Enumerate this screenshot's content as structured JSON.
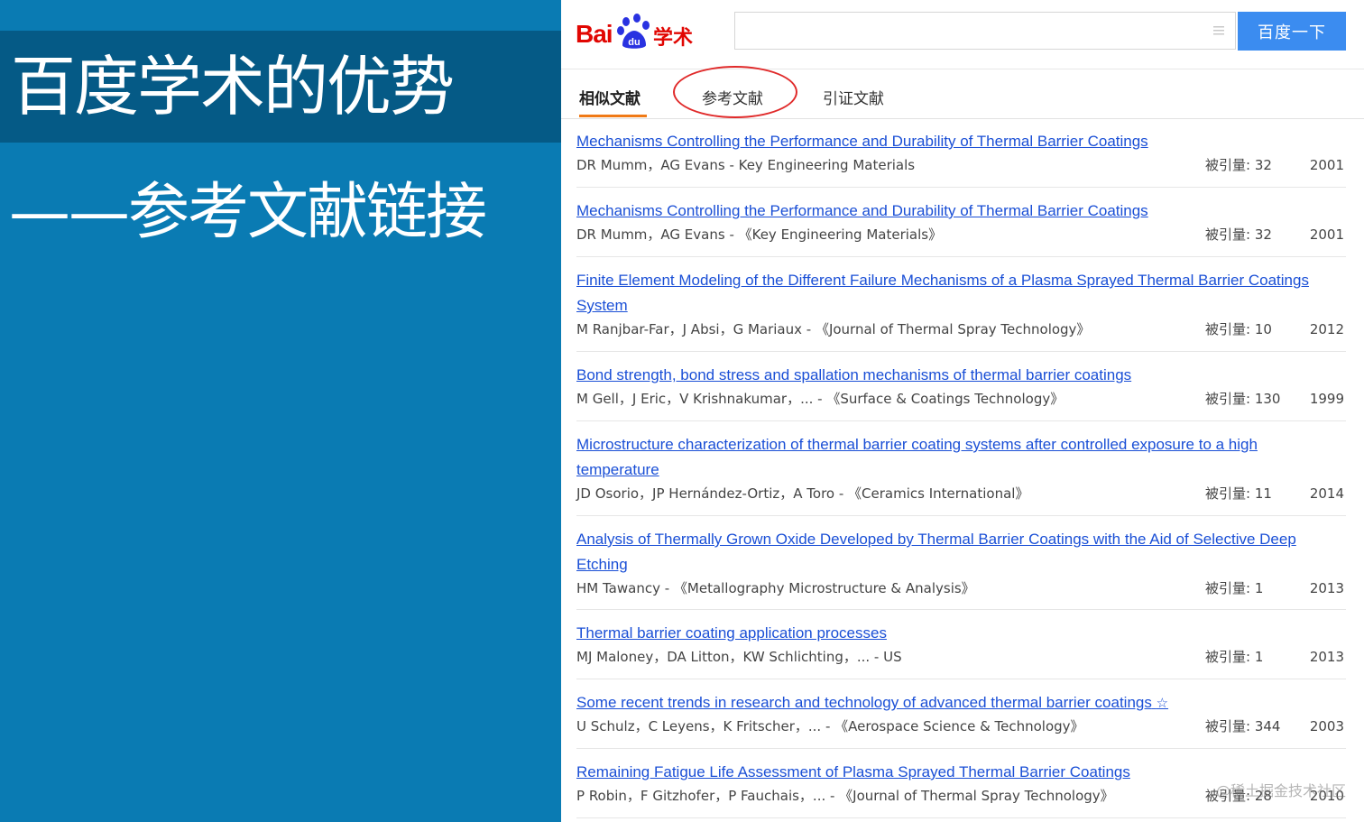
{
  "slide": {
    "title": "百度学术的优势",
    "subtitle": "——参考文献链接"
  },
  "header": {
    "logo_bai": "Bai",
    "logo_du": "du",
    "logo_xueshu": "学术",
    "search_value": "",
    "search_button": "百度一下"
  },
  "tabs": [
    {
      "label": "相似文献",
      "active": true
    },
    {
      "label": "参考文献",
      "active": false
    },
    {
      "label": "引证文献",
      "active": false
    }
  ],
  "results": [
    {
      "title": "Mechanisms Controlling the Performance and Durability of Thermal Barrier Coatings",
      "meta": "DR Mumm，AG Evans - Key Engineering Materials",
      "cite": "被引量: 32",
      "year": "2001"
    },
    {
      "title": "Mechanisms Controlling the Performance and Durability of Thermal Barrier Coatings",
      "meta": "DR Mumm，AG Evans - 《Key Engineering Materials》",
      "cite": "被引量: 32",
      "year": "2001"
    },
    {
      "title": "Finite Element Modeling of the Different Failure Mechanisms of a Plasma Sprayed Thermal Barrier Coatings System",
      "meta": "M Ranjbar-Far，J Absi，G Mariaux - 《Journal of Thermal Spray Technology》",
      "cite": "被引量: 10",
      "year": "2012"
    },
    {
      "title": "Bond strength, bond stress and spallation mechanisms of thermal barrier coatings",
      "meta": "M Gell，J Eric，V Krishnakumar，... - 《Surface & Coatings Technology》",
      "cite": "被引量: 130",
      "year": "1999"
    },
    {
      "title": "Microstructure characterization of thermal barrier coating systems after controlled exposure to a high temperature",
      "meta": "JD Osorio，JP Hernández-Ortiz，A Toro - 《Ceramics International》",
      "cite": "被引量: 11",
      "year": "2014"
    },
    {
      "title": "Analysis of Thermally Grown Oxide Developed by Thermal Barrier Coatings with the Aid of Selective Deep Etching",
      "meta": "HM Tawancy - 《Metallography Microstructure & Analysis》",
      "cite": "被引量: 1",
      "year": "2013"
    },
    {
      "title": "Thermal barrier coating application processes",
      "meta": "MJ Maloney，DA Litton，KW Schlichting，... - US",
      "cite": "被引量: 1",
      "year": "2013"
    },
    {
      "title": "Some recent trends in research and technology of advanced thermal barrier coatings",
      "meta": "U Schulz，C Leyens，K Fritscher，... - 《Aerospace Science & Technology》",
      "cite": "被引量: 344",
      "year": "2003"
    },
    {
      "title": "Remaining Fatigue Life Assessment of Plasma Sprayed Thermal Barrier Coatings",
      "meta": "P Robin，F Gitzhofer，P Fauchais，... - 《Journal of Thermal Spray Technology》",
      "cite": "被引量: 28",
      "year": "2010"
    }
  ],
  "watermark": "@稀土掘金技术社区",
  "colors": {
    "slide_bg": "#0a7bb3",
    "title_band": "#055a86",
    "link": "#1a4fd6",
    "tab_accent": "#f07a16",
    "search_button": "#3b8cf0",
    "circle": "#e02a2a"
  }
}
